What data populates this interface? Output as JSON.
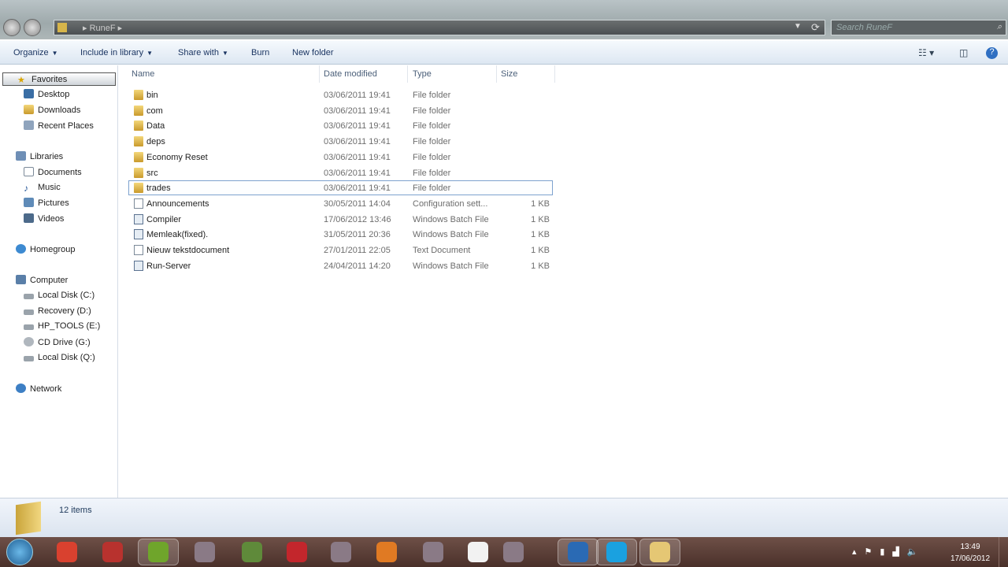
{
  "address": {
    "path": "RuneF",
    "search_placeholder": "Search RuneF"
  },
  "toolbar": {
    "organize": "Organize",
    "include": "Include in library",
    "share": "Share with",
    "burn": "Burn",
    "new_folder": "New folder"
  },
  "nav": {
    "favorites": "Favorites",
    "desktop": "Desktop",
    "downloads": "Downloads",
    "recent": "Recent Places",
    "libraries": "Libraries",
    "documents": "Documents",
    "music": "Music",
    "pictures": "Pictures",
    "videos": "Videos",
    "homegroup": "Homegroup",
    "computer": "Computer",
    "c": "Local Disk (C:)",
    "d": "Recovery (D:)",
    "e": "HP_TOOLS (E:)",
    "g": "CD Drive (G:)",
    "q": "Local Disk (Q:)",
    "network": "Network"
  },
  "columns": {
    "name": "Name",
    "date": "Date modified",
    "type": "Type",
    "size": "Size"
  },
  "files": [
    {
      "name": "bin",
      "date": "03/06/2011 19:41",
      "type": "File folder",
      "size": "",
      "icon": "folder"
    },
    {
      "name": "com",
      "date": "03/06/2011 19:41",
      "type": "File folder",
      "size": "",
      "icon": "folder"
    },
    {
      "name": "Data",
      "date": "03/06/2011 19:41",
      "type": "File folder",
      "size": "",
      "icon": "folder"
    },
    {
      "name": "deps",
      "date": "03/06/2011 19:41",
      "type": "File folder",
      "size": "",
      "icon": "folder"
    },
    {
      "name": "Economy Reset",
      "date": "03/06/2011 19:41",
      "type": "File folder",
      "size": "",
      "icon": "folder"
    },
    {
      "name": "src",
      "date": "03/06/2011 19:41",
      "type": "File folder",
      "size": "",
      "icon": "folder"
    },
    {
      "name": "trades",
      "date": "03/06/2011 19:41",
      "type": "File folder",
      "size": "",
      "icon": "folder"
    },
    {
      "name": "Announcements",
      "date": "30/05/2011 14:04",
      "type": "Configuration sett...",
      "size": "1 KB",
      "icon": "doc"
    },
    {
      "name": "Compiler",
      "date": "17/06/2012 13:46",
      "type": "Windows Batch File",
      "size": "1 KB",
      "icon": "bat"
    },
    {
      "name": "Memleak(fixed).",
      "date": "31/05/2011 20:36",
      "type": "Windows Batch File",
      "size": "1 KB",
      "icon": "bat"
    },
    {
      "name": "Nieuw tekstdocument",
      "date": "27/01/2011 22:05",
      "type": "Text Document",
      "size": "1 KB",
      "icon": "doc"
    },
    {
      "name": "Run-Server",
      "date": "24/04/2011 14:20",
      "type": "Windows Batch File",
      "size": "1 KB",
      "icon": "bat"
    }
  ],
  "selected_row": 6,
  "status": {
    "count": "12 items"
  },
  "clock": {
    "time": "13:49",
    "date": "17/06/2012"
  },
  "taskbar": [
    "chrome",
    "winrar",
    "spotify",
    "app",
    "minecraft",
    "dice",
    "app",
    "firefox",
    "app",
    "file",
    "app",
    "itunes",
    "skype",
    "explorer"
  ]
}
